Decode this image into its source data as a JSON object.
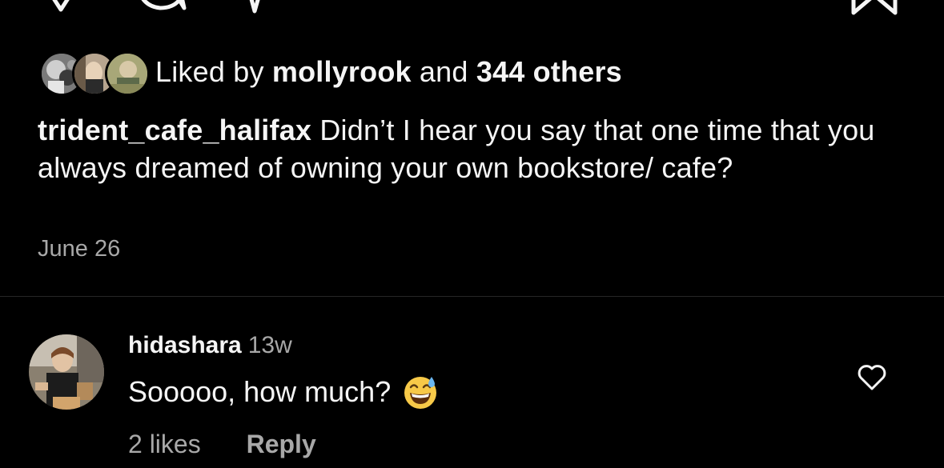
{
  "post": {
    "liked_by_prefix": "Liked by ",
    "liked_by_user": "mollyrook",
    "liked_by_middle": " and ",
    "liked_by_count": "344 others",
    "caption_user": "trident_cafe_halifax",
    "caption_text": " Didn’t I hear you say that one time that you always dreamed of owning your own bookstore/ cafe?",
    "date": "June 26"
  },
  "comment": {
    "username": "hidashara",
    "time": "13w",
    "text": "Sooooo, how much?",
    "emoji": "grinning-face-with-sweat",
    "likes": "2 likes",
    "reply_label": "Reply"
  },
  "icons": [
    "heart-icon",
    "comment-icon",
    "share-icon",
    "bookmark-icon"
  ],
  "colors": {
    "background": "#000000",
    "text": "#f5f5f5",
    "secondary_text": "#a8a8a8",
    "divider": "#262626"
  }
}
